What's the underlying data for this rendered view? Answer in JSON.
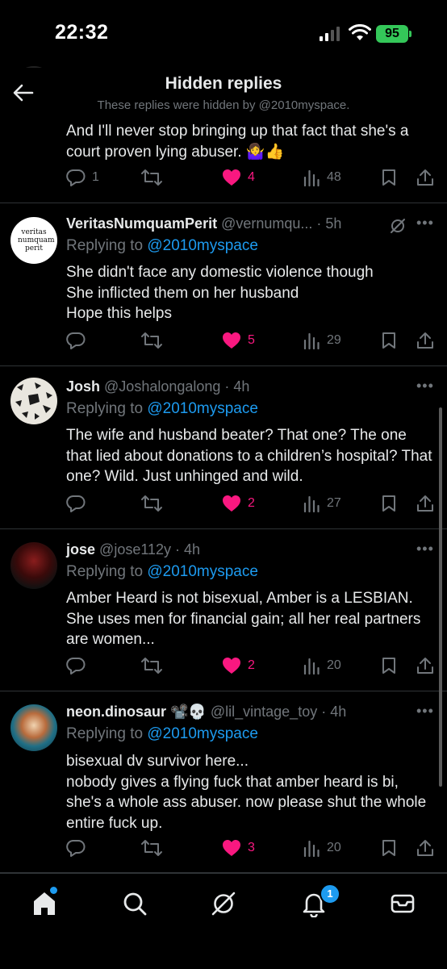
{
  "status": {
    "time": "22:32",
    "battery": "95"
  },
  "header": {
    "title": "Hidden replies",
    "subtitle": "These replies were hidden by @2010myspace."
  },
  "tweets": [
    {
      "name": "",
      "handle": "",
      "replying_prefix": "",
      "replying_to": "",
      "text": "And I'll never stop bringing up that fact that she's a court proven lying abuser. 🤷‍♀️👍",
      "counts": {
        "replies": "1",
        "retweets": "",
        "likes": "4",
        "views": "48"
      }
    },
    {
      "name": "VeritasNumquamPerit",
      "handle": "@vernumqu... · 5h",
      "avatar_text": "veritas numquam perit",
      "replying_prefix": "Replying to ",
      "replying_to": "@2010myspace",
      "text": "She didn't face any domestic violence though\nShe inflicted them on her husband\nHope this helps",
      "counts": {
        "replies": "",
        "retweets": "",
        "likes": "5",
        "views": "29"
      }
    },
    {
      "name": "Josh",
      "handle": "@Joshalongalong · 4h",
      "replying_prefix": "Replying to ",
      "replying_to": "@2010myspace",
      "text": "The wife and husband beater? That one? The one that lied about donations to a children’s hospital? That one? Wild. Just unhinged and wild.",
      "counts": {
        "replies": "",
        "retweets": "",
        "likes": "2",
        "views": "27"
      }
    },
    {
      "name": "jose",
      "handle": "@jose112y · 4h",
      "replying_prefix": "Replying to ",
      "replying_to": "@2010myspace",
      "text": "Amber Heard is not bisexual, Amber is a LESBIAN. She uses men for financial gain; all her real partners are women...",
      "counts": {
        "replies": "",
        "retweets": "",
        "likes": "2",
        "views": "20"
      }
    },
    {
      "name": "neon.dinosaur 📽️💀",
      "handle": "@lil_vintage_toy · 4h",
      "replying_prefix": "Replying to ",
      "replying_to": "@2010myspace",
      "text": "bisexual dv survivor here...\nnobody gives a flying fuck that amber heard is bi, she's a whole ass abuser. now please shut the whole entire fuck up.",
      "counts": {
        "replies": "",
        "retweets": "",
        "likes": "3",
        "views": "20"
      }
    }
  ],
  "tabbar": {
    "notification_badge": "1"
  },
  "colors": {
    "accent": "#1d9bf0",
    "like": "#f91880",
    "muted": "#71767b",
    "text": "#e7e9ea",
    "background": "#000000"
  }
}
